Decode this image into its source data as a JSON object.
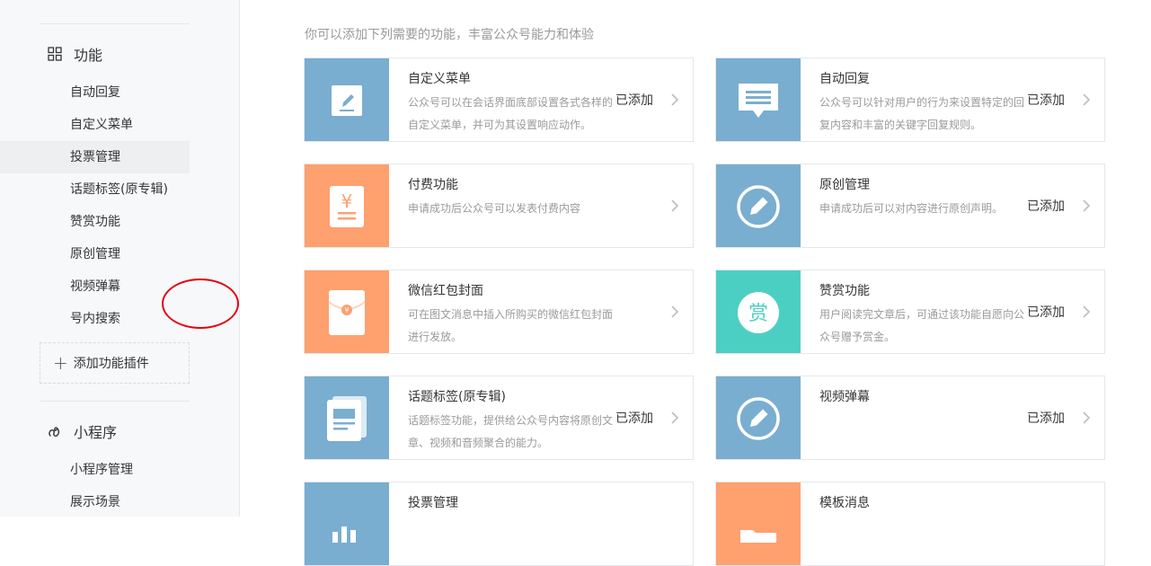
{
  "sidebar": {
    "features_section": {
      "title": "功能",
      "icon": "grid-icon"
    },
    "items": [
      {
        "label": "自动回复"
      },
      {
        "label": "自定义菜单"
      },
      {
        "label": "投票管理"
      },
      {
        "label": "话题标签(原专辑)"
      },
      {
        "label": "赞赏功能"
      },
      {
        "label": "原创管理"
      },
      {
        "label": "视频弹幕"
      },
      {
        "label": "号内搜索"
      }
    ],
    "active_item": "投票管理",
    "add_plugin_label": "添加功能插件",
    "miniprogram_section": {
      "title": "小程序",
      "icon": "link-icon"
    },
    "mini_items": [
      {
        "label": "小程序管理"
      },
      {
        "label": "展示场景"
      }
    ]
  },
  "main": {
    "hint": "你可以添加下列需要的功能，丰富公众号能力和体验",
    "cards": [
      {
        "title": "自定义菜单",
        "desc": "公众号可以在会话界面底部设置各式各样的自定义菜单，并可为其设置响应动作。",
        "status": "已添加",
        "icon": "edit-icon",
        "color": "#79aed0"
      },
      {
        "title": "自动回复",
        "desc": "公众号可以针对用户的行为来设置特定的回复内容和丰富的关键字回复规则。",
        "status": "已添加",
        "icon": "message-icon",
        "color": "#79aed0"
      },
      {
        "title": "付费功能",
        "desc": "申请成功后公众号可以发表付费内容",
        "status": "",
        "icon": "yen-icon",
        "color": "#ffa06f"
      },
      {
        "title": "原创管理",
        "desc": "申请成功后可以对内容进行原创声明。",
        "status": "已添加",
        "icon": "pencil-circle-icon",
        "color": "#79aed0"
      },
      {
        "title": "微信红包封面",
        "desc": "可在图文消息中插入所购买的微信红包封面进行发放。",
        "status": "",
        "icon": "red-envelope-icon",
        "color": "#ffa06f"
      },
      {
        "title": "赞赏功能",
        "desc": "用户阅读完文章后，可通过该功能自愿向公众号赠予赏金。",
        "status": "已添加",
        "icon": "reward-icon",
        "color": "#4ccfc3",
        "icon_text": "赏"
      },
      {
        "title": "话题标签(原专辑)",
        "desc": "话题标签功能，提供给公众号内容将原创文章、视频和音频聚合的能力。",
        "status": "已添加",
        "icon": "album-icon",
        "color": "#79aed0"
      },
      {
        "title": "视频弹幕",
        "desc": "",
        "status": "已添加",
        "icon": "pencil-circle-icon",
        "color": "#79aed0"
      },
      {
        "title": "投票管理",
        "desc": "",
        "status": "",
        "icon": "bar-chart-icon",
        "color": "#79aed0"
      },
      {
        "title": "模板消息",
        "desc": "",
        "status": "",
        "icon": "folder-icon",
        "color": "#ffa06f"
      }
    ]
  }
}
